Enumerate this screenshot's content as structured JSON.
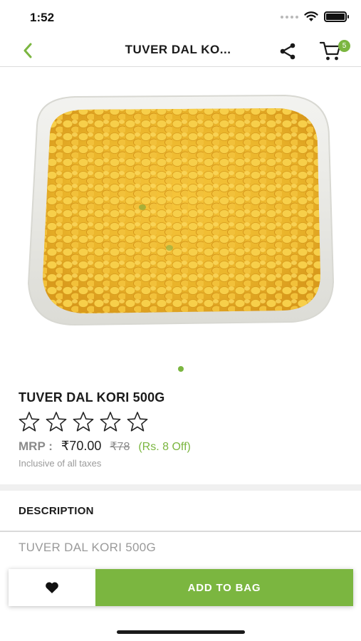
{
  "status_bar": {
    "time": "1:52"
  },
  "nav": {
    "title": "TUVER DAL KO...",
    "cart_count": "5"
  },
  "product": {
    "name": "TUVER DAL KORI 500G",
    "rating": {
      "value": 0,
      "max": 5
    },
    "mrp_label": "MRP :",
    "price": "₹70.00",
    "original_price": "₹78",
    "discount": "(Rs. 8 Off)",
    "tax_note": "Inclusive of all taxes",
    "image_pages": {
      "current": 1,
      "total": 1
    }
  },
  "description": {
    "heading": "DESCRIPTION",
    "text": "TUVER DAL KORI 500G"
  },
  "actions": {
    "add_to_bag": "ADD TO BAG"
  },
  "colors": {
    "accent": "#7bb640",
    "text_dark": "#1b1b1b",
    "text_muted": "#9a9a9a",
    "separator": "#f0f0f0"
  },
  "icons": {
    "back": "chevron-left-icon",
    "share": "share-icon",
    "cart": "cart-icon",
    "wishlist": "heart-icon",
    "rating": "star-outline-icon"
  }
}
